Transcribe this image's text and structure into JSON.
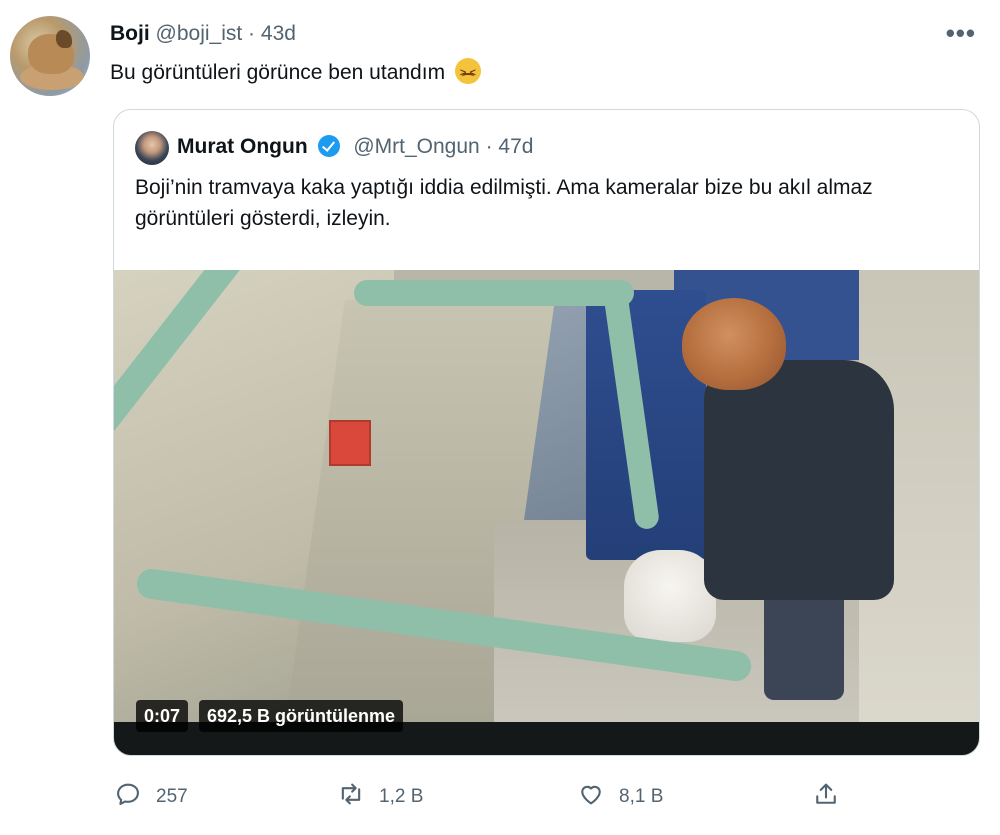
{
  "tweet": {
    "author_name": "Boji",
    "author_handle": "@boji_ist",
    "separator": "·",
    "time": "43d",
    "text": "Bu görüntüleri görünce ben utandım",
    "more_label": "•••"
  },
  "quoted": {
    "author_name": "Murat Ongun",
    "author_handle": "@Mrt_Ongun",
    "separator": "·",
    "time": "47d",
    "text": "Boji’nin tramvaya kaka yaptığı iddia edilmişti. Ama kameralar bize bu akıl almaz görüntüleri gösterdi, izleyin.",
    "video": {
      "duration": "0:07",
      "views": "692,5 B görüntülenme"
    }
  },
  "actions": {
    "reply_count": "257",
    "retweet_count": "1,2 B",
    "like_count": "8,1 B"
  },
  "colors": {
    "text_primary": "#0f1419",
    "text_secondary": "#536471",
    "verified_blue": "#1d9bf0",
    "border": "#cfd9de"
  }
}
